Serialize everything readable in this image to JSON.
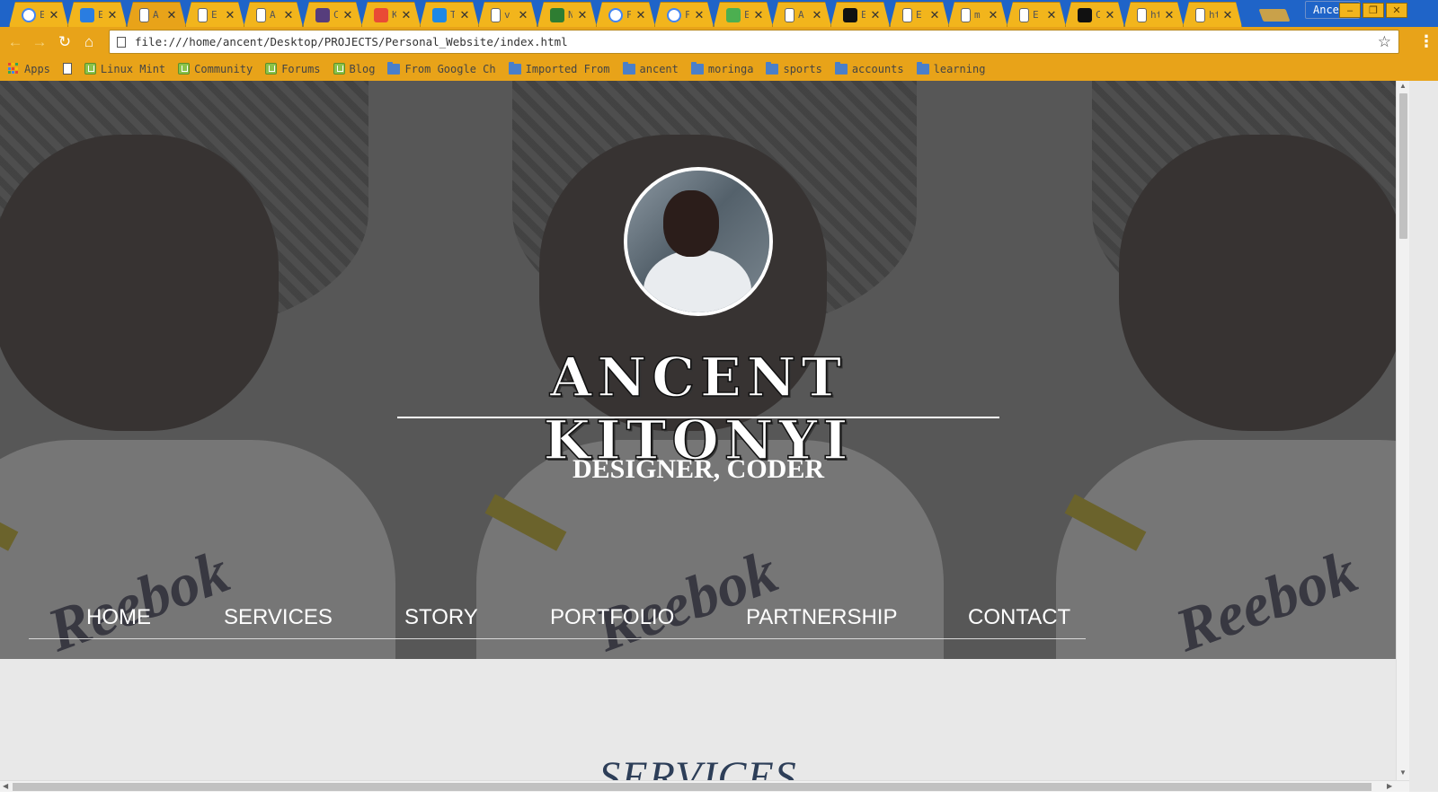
{
  "browser": {
    "tabs": [
      {
        "label": "E",
        "icon": "google-icon",
        "icon_color": "#4285f4"
      },
      {
        "label": "E",
        "icon": "chart-icon",
        "icon_color": "#2a7de1"
      },
      {
        "label": "A",
        "icon": "page-icon",
        "icon_color": "#ffffff"
      },
      {
        "label": "E",
        "icon": "page-icon",
        "icon_color": "#ffffff"
      },
      {
        "label": "A",
        "icon": "page-icon",
        "icon_color": "#ffffff"
      },
      {
        "label": "C",
        "icon": "bootstrap-icon",
        "icon_color": "#563d7c"
      },
      {
        "label": "K",
        "icon": "colorful-icon",
        "icon_color": "#e94b35"
      },
      {
        "label": "T",
        "icon": "f-icon",
        "icon_color": "#1e88e5"
      },
      {
        "label": "v",
        "icon": "page-icon",
        "icon_color": "#ffffff"
      },
      {
        "label": "N",
        "icon": "xul-icon",
        "icon_color": "#2e7d32"
      },
      {
        "label": "F",
        "icon": "google-icon",
        "icon_color": "#4285f4"
      },
      {
        "label": "F",
        "icon": "google-icon",
        "icon_color": "#4285f4"
      },
      {
        "label": "E",
        "icon": "w3-icon",
        "icon_color": "#4caf50"
      },
      {
        "label": "A",
        "icon": "page-icon",
        "icon_color": "#ffffff"
      },
      {
        "label": "E",
        "icon": "camera-icon",
        "icon_color": "#111111"
      },
      {
        "label": "E",
        "icon": "page-icon",
        "icon_color": "#ffffff"
      },
      {
        "label": "m",
        "icon": "page-icon",
        "icon_color": "#ffffff"
      },
      {
        "label": "E",
        "icon": "page-icon",
        "icon_color": "#ffffff"
      },
      {
        "label": "Cen",
        "icon": "github-icon",
        "icon_color": "#111111"
      },
      {
        "label": "htt",
        "icon": "page-icon",
        "icon_color": "#ffffff"
      },
      {
        "label": "htt",
        "icon": "page-icon",
        "icon_color": "#ffffff"
      }
    ],
    "profile_name": "Ancent",
    "url": "file:///home/ancent/Desktop/PROJECTS/Personal_Website/index.html",
    "bookmarks": [
      {
        "label": "Apps",
        "icon": "apps-grid-icon"
      },
      {
        "label": "",
        "icon": "page-icon"
      },
      {
        "label": "Linux Mint",
        "icon": "mint-icon"
      },
      {
        "label": "Community",
        "icon": "mint-icon"
      },
      {
        "label": "Forums",
        "icon": "mint-icon"
      },
      {
        "label": "Blog",
        "icon": "mint-icon"
      },
      {
        "label": "From Google Ch",
        "icon": "folder-icon"
      },
      {
        "label": "Imported From",
        "icon": "folder-icon"
      },
      {
        "label": "ancent",
        "icon": "folder-icon"
      },
      {
        "label": "moringa",
        "icon": "folder-icon"
      },
      {
        "label": "sports",
        "icon": "folder-icon"
      },
      {
        "label": "accounts",
        "icon": "folder-icon"
      },
      {
        "label": "learning",
        "icon": "folder-icon"
      }
    ],
    "colors": {
      "tabbar": "#1f64c8",
      "toolbar": "#e8a319",
      "tab": "#f2b51c"
    }
  },
  "page": {
    "hero": {
      "name": "ANCENT KITONYI",
      "tagline": "DESIGNER, CODER",
      "background_brand_text": "Reebok"
    },
    "nav": [
      "HOME",
      "SERVICES",
      "STORY",
      "PORTFOLIO",
      "PARTNERSHIP",
      "CONTACT"
    ],
    "section_title": "SERVICES"
  }
}
